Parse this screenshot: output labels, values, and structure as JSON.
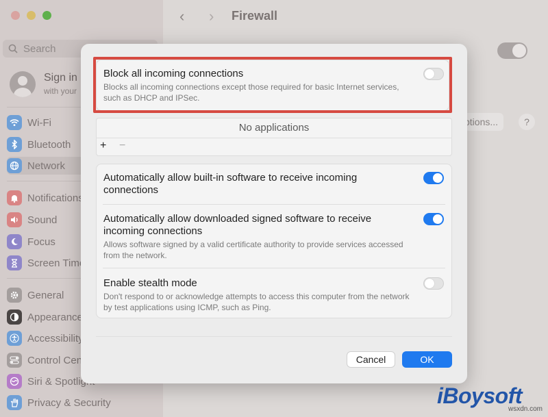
{
  "window": {
    "title": "Firewall",
    "search_placeholder": "Search",
    "nav_back": "‹",
    "nav_forward": "›"
  },
  "sidebar": {
    "signin_title": "Sign in",
    "signin_sub": "with your",
    "items": [
      {
        "label": "Wi-Fi",
        "icon": "wifi-icon",
        "color": "#6e9fd6"
      },
      {
        "label": "Bluetooth",
        "icon": "bluetooth-icon",
        "color": "#6e9fd6"
      },
      {
        "label": "Network",
        "icon": "globe-icon",
        "color": "#6e9fd6"
      },
      {
        "label": "Notifications",
        "icon": "bell-icon",
        "color": "#d98484"
      },
      {
        "label": "Sound",
        "icon": "speaker-icon",
        "color": "#d98484"
      },
      {
        "label": "Focus",
        "icon": "moon-icon",
        "color": "#8f86c9"
      },
      {
        "label": "Screen Time",
        "icon": "hourglass-icon",
        "color": "#8f86c9"
      },
      {
        "label": "General",
        "icon": "gear-icon",
        "color": "#a49e9d"
      },
      {
        "label": "Appearance",
        "icon": "appearance-icon",
        "color": "#4a4544"
      },
      {
        "label": "Accessibility",
        "icon": "accessibility-icon",
        "color": "#6e9fd6"
      },
      {
        "label": "Control Center",
        "icon": "control-center-icon",
        "color": "#a49e9d"
      },
      {
        "label": "Siri & Spotlight",
        "icon": "siri-icon",
        "color": "#b57cc8"
      },
      {
        "label": "Privacy & Security",
        "icon": "hand-icon",
        "color": "#6e9fd6"
      }
    ]
  },
  "background": {
    "options_label": "ptions...",
    "help_label": "?"
  },
  "sheet": {
    "block_all": {
      "title": "Block all incoming connections",
      "desc": "Blocks all incoming connections except those required for basic Internet services, such as DHCP and IPSec.",
      "enabled": false
    },
    "app_list": {
      "empty_text": "No applications",
      "add_label": "+",
      "remove_label": "−"
    },
    "auto_builtin": {
      "title": "Automatically allow built-in software to receive incoming connections",
      "enabled": true
    },
    "auto_signed": {
      "title": "Automatically allow downloaded signed software to receive incoming connections",
      "desc": "Allows software signed by a valid certificate authority to provide services accessed from the network.",
      "enabled": true
    },
    "stealth": {
      "title": "Enable stealth mode",
      "desc": "Don't respond to or acknowledge attempts to access this computer from the network by test applications using ICMP, such as Ping.",
      "enabled": false
    },
    "cancel_label": "Cancel",
    "ok_label": "OK"
  },
  "watermark": {
    "brand": "iBoysoft",
    "site": "wsxdn.com"
  },
  "colors": {
    "accent": "#1f7aef",
    "highlight": "#d64a41"
  }
}
